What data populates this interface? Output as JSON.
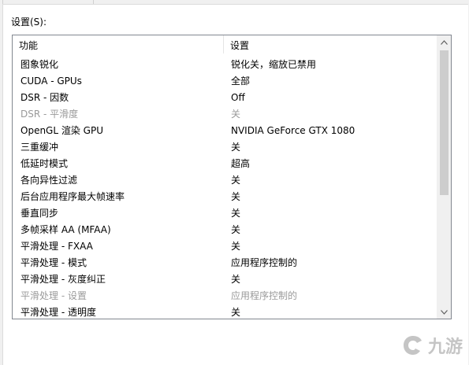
{
  "settings_label": "设置(S):",
  "columns": {
    "feature": "功能",
    "setting": "设置"
  },
  "rows": [
    {
      "feature": "图象锐化",
      "value": "锐化关，缩放已禁用",
      "disabled": false
    },
    {
      "feature": "CUDA - GPUs",
      "value": "全部",
      "disabled": false
    },
    {
      "feature": "DSR - 因数",
      "value": "Off",
      "disabled": false
    },
    {
      "feature": "DSR - 平滑度",
      "value": "关",
      "disabled": true
    },
    {
      "feature": "OpenGL 渲染 GPU",
      "value": "NVIDIA GeForce GTX 1080",
      "disabled": false
    },
    {
      "feature": "三重缓冲",
      "value": "关",
      "disabled": false
    },
    {
      "feature": "低延时模式",
      "value": "超高",
      "disabled": false
    },
    {
      "feature": "各向异性过滤",
      "value": "关",
      "disabled": false
    },
    {
      "feature": "后台应用程序最大帧速率",
      "value": "关",
      "disabled": false
    },
    {
      "feature": "垂直同步",
      "value": "关",
      "disabled": false
    },
    {
      "feature": "多帧采样 AA (MFAA)",
      "value": "关",
      "disabled": false
    },
    {
      "feature": "平滑处理 - FXAA",
      "value": "关",
      "disabled": false
    },
    {
      "feature": "平滑处理 - 模式",
      "value": "应用程序控制的",
      "disabled": false
    },
    {
      "feature": "平滑处理 - 灰度纠正",
      "value": "关",
      "disabled": false
    },
    {
      "feature": "平滑处理 - 设置",
      "value": "应用程序控制的",
      "disabled": true
    },
    {
      "feature": "平滑处理 - 透明度",
      "value": "关",
      "disabled": false
    }
  ],
  "icons": {
    "scroll_up": "scroll-up-arrow-icon",
    "scroll_down": "scroll-down-arrow-icon",
    "watermark": "九游-logo"
  },
  "watermark_text": "九游"
}
